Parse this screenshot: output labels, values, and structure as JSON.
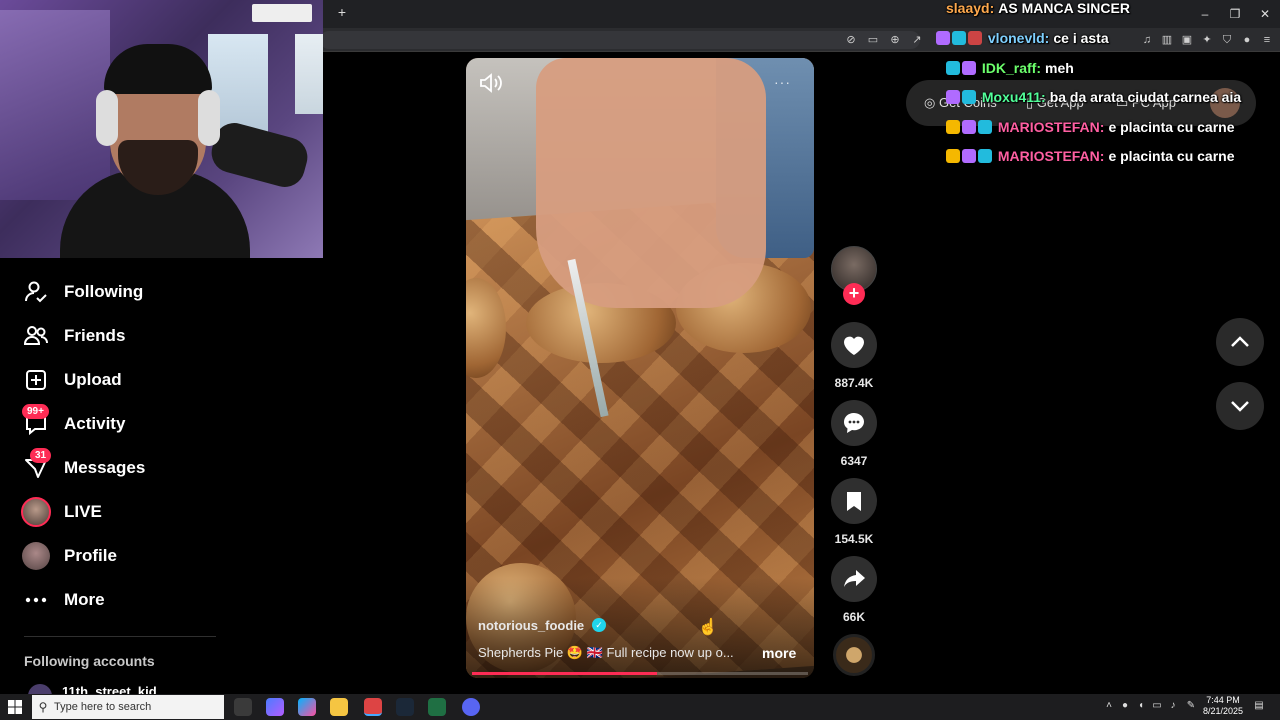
{
  "browser": {
    "new_tab_label": "+",
    "window_controls": [
      "–",
      "❐",
      "✕"
    ]
  },
  "sidebar": {
    "items": [
      {
        "label": "Following",
        "icon": "following-icon"
      },
      {
        "label": "Friends",
        "icon": "friends-icon"
      },
      {
        "label": "Upload",
        "icon": "upload-icon"
      },
      {
        "label": "Activity",
        "icon": "activity-icon",
        "badge": "99+"
      },
      {
        "label": "Messages",
        "icon": "messages-icon",
        "badge": "31"
      },
      {
        "label": "LIVE",
        "icon": "live-avatar-icon"
      },
      {
        "label": "Profile",
        "icon": "profile-avatar-icon"
      },
      {
        "label": "More",
        "icon": "more-icon"
      }
    ],
    "following_accounts_heading": "Following accounts",
    "following_accounts": [
      "11th_street_kid"
    ]
  },
  "video": {
    "author": "notorious_foodie",
    "caption": "Shepherds Pie 🤩 🇬🇧 Full recipe now up o...",
    "more_label": "more",
    "options_label": "···",
    "progress_fraction": 0.55
  },
  "actions": {
    "likes": "887.4K",
    "comments": "6347",
    "bookmarks": "154.5K",
    "shares": "66K"
  },
  "header": {
    "coins": "Get Coins",
    "get_app": "Get App",
    "pc_app": "PC App"
  },
  "chat": [
    {
      "user": "slaayd:",
      "message": "AS MANCA SINCER",
      "color": "#ffa94d"
    },
    {
      "user": "vlonevld:",
      "message": "ce i asta",
      "color": "#7fd0ff"
    },
    {
      "user": "IDK_raff:",
      "message": "meh",
      "color": "#6cff6c"
    },
    {
      "user": "Moxu411:",
      "message": "ba da arata ciudat carnea aia",
      "color": "#52ff9a"
    },
    {
      "user": "MARIOSTEFAN:",
      "message": "e placinta cu carne",
      "color": "#ff5fa2"
    },
    {
      "user": "MARIOSTEFAN:",
      "message": "e placinta cu carne",
      "color": "#ff5fa2"
    }
  ],
  "taskbar": {
    "search_placeholder": "Type here to search",
    "time": "7:44 PM",
    "date": "8/21/2025"
  },
  "colors": {
    "accent": "#fe2c55",
    "background": "#000000",
    "verified": "#20d5ec"
  }
}
